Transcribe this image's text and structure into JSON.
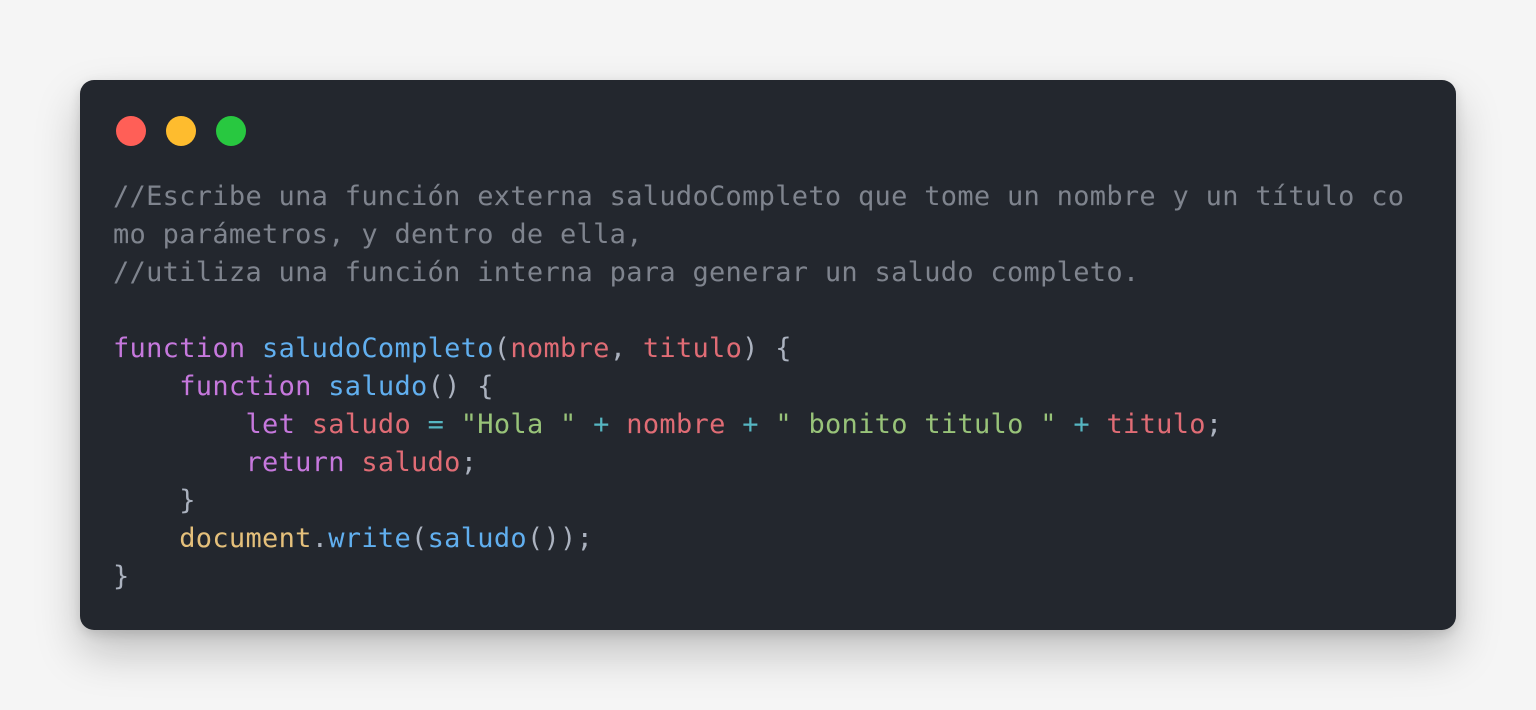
{
  "window": {
    "background": "#23272e",
    "controls": [
      {
        "name": "close",
        "color": "#ff5f57"
      },
      {
        "name": "minimize",
        "color": "#febc2e"
      },
      {
        "name": "zoom",
        "color": "#28c840"
      }
    ]
  },
  "code": {
    "lines": [
      [
        {
          "t": "comment",
          "v": "//Escribe una función externa saludoCompleto que tome un nombre y un título co"
        }
      ],
      [
        {
          "t": "comment",
          "v": "mo parámetros, y dentro de ella,"
        }
      ],
      [
        {
          "t": "comment",
          "v": "//utiliza una función interna para generar un saludo completo."
        }
      ],
      [],
      [
        {
          "t": "keyword",
          "v": "function"
        },
        {
          "t": "plain",
          "v": " "
        },
        {
          "t": "fn",
          "v": "saludoCompleto"
        },
        {
          "t": "punct",
          "v": "("
        },
        {
          "t": "param",
          "v": "nombre"
        },
        {
          "t": "punct",
          "v": ", "
        },
        {
          "t": "param",
          "v": "titulo"
        },
        {
          "t": "punct",
          "v": ") {"
        }
      ],
      [
        {
          "t": "plain",
          "v": "    "
        },
        {
          "t": "keyword",
          "v": "function"
        },
        {
          "t": "plain",
          "v": " "
        },
        {
          "t": "fn",
          "v": "saludo"
        },
        {
          "t": "punct",
          "v": "() {"
        }
      ],
      [
        {
          "t": "plain",
          "v": "        "
        },
        {
          "t": "keyword",
          "v": "let"
        },
        {
          "t": "plain",
          "v": " "
        },
        {
          "t": "var",
          "v": "saludo"
        },
        {
          "t": "plain",
          "v": " "
        },
        {
          "t": "op",
          "v": "="
        },
        {
          "t": "plain",
          "v": " "
        },
        {
          "t": "string",
          "v": "\"Hola \""
        },
        {
          "t": "plain",
          "v": " "
        },
        {
          "t": "op",
          "v": "+"
        },
        {
          "t": "plain",
          "v": " "
        },
        {
          "t": "var",
          "v": "nombre"
        },
        {
          "t": "plain",
          "v": " "
        },
        {
          "t": "op",
          "v": "+"
        },
        {
          "t": "plain",
          "v": " "
        },
        {
          "t": "string",
          "v": "\" bonito titulo \""
        },
        {
          "t": "plain",
          "v": " "
        },
        {
          "t": "op",
          "v": "+"
        },
        {
          "t": "plain",
          "v": " "
        },
        {
          "t": "var",
          "v": "titulo"
        },
        {
          "t": "punct",
          "v": ";"
        }
      ],
      [
        {
          "t": "plain",
          "v": "        "
        },
        {
          "t": "keyword",
          "v": "return"
        },
        {
          "t": "plain",
          "v": " "
        },
        {
          "t": "var",
          "v": "saludo"
        },
        {
          "t": "punct",
          "v": ";"
        }
      ],
      [
        {
          "t": "plain",
          "v": "    "
        },
        {
          "t": "punct",
          "v": "}"
        }
      ],
      [
        {
          "t": "plain",
          "v": "    "
        },
        {
          "t": "object",
          "v": "document"
        },
        {
          "t": "punct",
          "v": "."
        },
        {
          "t": "fn",
          "v": "write"
        },
        {
          "t": "punct",
          "v": "("
        },
        {
          "t": "fn",
          "v": "saludo"
        },
        {
          "t": "punct",
          "v": "());"
        }
      ],
      [
        {
          "t": "punct",
          "v": "}"
        }
      ]
    ]
  }
}
